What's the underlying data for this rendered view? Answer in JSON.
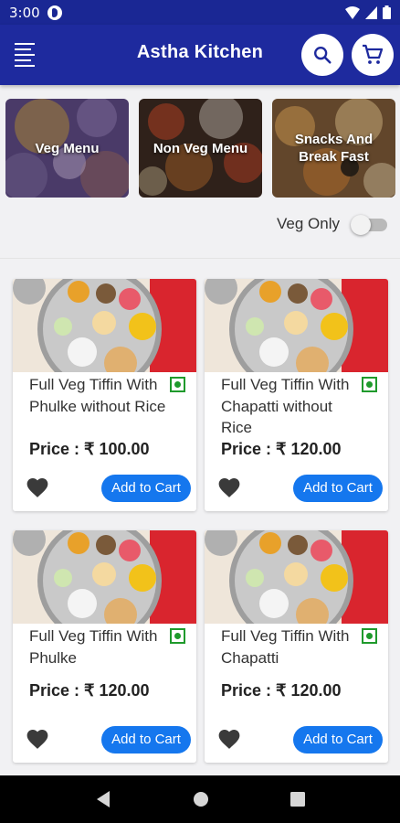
{
  "status_bar": {
    "time": "3:00"
  },
  "app_bar": {
    "title": "Astha Kitchen"
  },
  "categories": [
    {
      "label": "Veg Menu"
    },
    {
      "label": "Non Veg Menu"
    },
    {
      "label": "Snacks And Break Fast"
    }
  ],
  "filter": {
    "veg_only_label": "Veg Only",
    "veg_only_on": false
  },
  "products": [
    {
      "title": "Full Veg Tiffin With Phulke without Rice",
      "price": "Price : ₹ 100.00",
      "add_label": "Add to Cart"
    },
    {
      "title": "Full Veg Tiffin With Chapatti without Rice",
      "price": "Price : ₹ 120.00",
      "add_label": "Add to Cart"
    },
    {
      "title": "Full Veg Tiffin With Phulke",
      "price": "Price : ₹ 120.00",
      "add_label": "Add to Cart"
    },
    {
      "title": "Full Veg Tiffin With Chapatti",
      "price": "Price : ₹ 120.00",
      "add_label": "Add to Cart"
    }
  ],
  "colors": {
    "primary": "#1e2a9e",
    "accent": "#1577ee",
    "veg": "#1f9a2c"
  }
}
